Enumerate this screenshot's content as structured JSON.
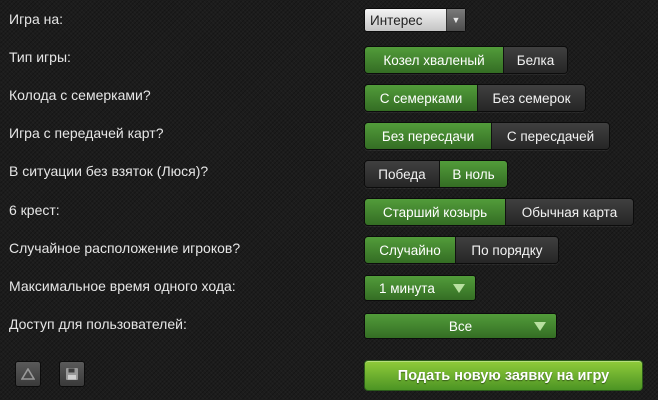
{
  "rows": [
    {
      "label": "Игра на:",
      "kind": "dropdown",
      "value": "Интерес"
    },
    {
      "label": "Тип игры:",
      "kind": "segmented",
      "options": [
        "Козел хваленый",
        "Белка"
      ],
      "selected": 0
    },
    {
      "label": "Колода с семерками?",
      "kind": "segmented",
      "options": [
        "С семерками",
        "Без семерок"
      ],
      "selected": 0
    },
    {
      "label": "Игра с передачей карт?",
      "kind": "segmented",
      "options": [
        "Без пересдачи",
        "С пересдачей"
      ],
      "selected": 0
    },
    {
      "label": "В ситуации без взяток (Люся)?",
      "kind": "segmented",
      "options": [
        "Победа",
        "В ноль"
      ],
      "selected": 1
    },
    {
      "label": "6 крест:",
      "kind": "segmented",
      "options": [
        "Старший козырь",
        "Обычная карта"
      ],
      "selected": 0
    },
    {
      "label": "Случайное расположение игроков?",
      "kind": "segmented",
      "options": [
        "Случайно",
        "По порядку"
      ],
      "selected": 0
    },
    {
      "label": "Максимальное время одного хода:",
      "kind": "dropdown",
      "value": "1 минута"
    },
    {
      "label": "Доступ для пользователей:",
      "kind": "dropdown",
      "value": "Все"
    }
  ],
  "footer": {
    "submit_label": "Подать новую заявку на игру",
    "icons": [
      "up-arrow-icon",
      "floppy-disk-icon"
    ]
  },
  "colors": {
    "background": "#1c1c1c",
    "segment_selected": "#4a8f33",
    "segment_unselected": "#333333",
    "submit": "#72b32f",
    "label_text": "#e6e6e6"
  }
}
